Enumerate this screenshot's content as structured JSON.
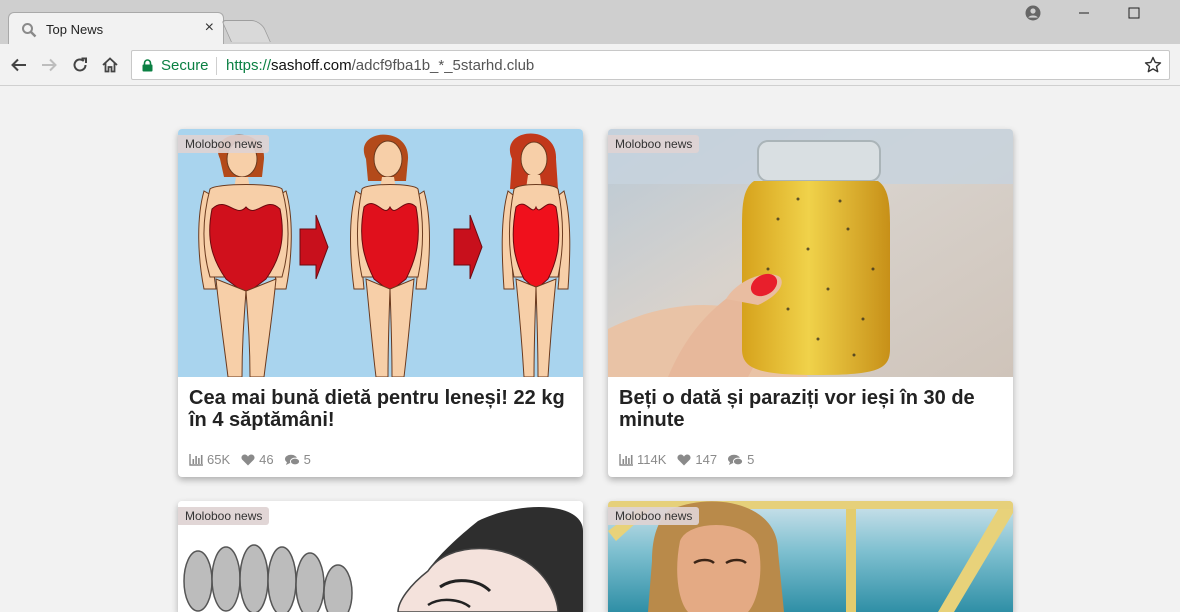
{
  "browser": {
    "tab_title": "Top News",
    "tab_close": "×",
    "secure_label": "Secure",
    "url_scheme": "https://",
    "url_host": "sashoff.com",
    "url_path": "/adcf9fba1b_*_5starhd.club"
  },
  "colors": {
    "secure_green": "#0b8043",
    "card_bg": "#ffffff",
    "page_bg": "#f2f2f2",
    "badge_bg": "#ded2d2"
  },
  "icons": [
    "search-icon",
    "close-icon",
    "profile-icon",
    "minimize-icon",
    "maximize-icon",
    "back-icon",
    "forward-icon",
    "reload-icon",
    "home-icon",
    "lock-icon",
    "star-icon",
    "views-icon",
    "likes-icon",
    "comments-icon"
  ],
  "cards": [
    {
      "badge": "Moloboo news",
      "title": "Cea mai bună dietă pentru leneși! 22 kg în 4 săptămâni!",
      "views": "65K",
      "likes": "46",
      "comments": "5"
    },
    {
      "badge": "Moloboo news",
      "title": "Beți o dată și paraziți vor ieși în 30 de minute",
      "views": "114K",
      "likes": "147",
      "comments": "5"
    },
    {
      "badge": "Moloboo news"
    },
    {
      "badge": "Moloboo news"
    }
  ]
}
